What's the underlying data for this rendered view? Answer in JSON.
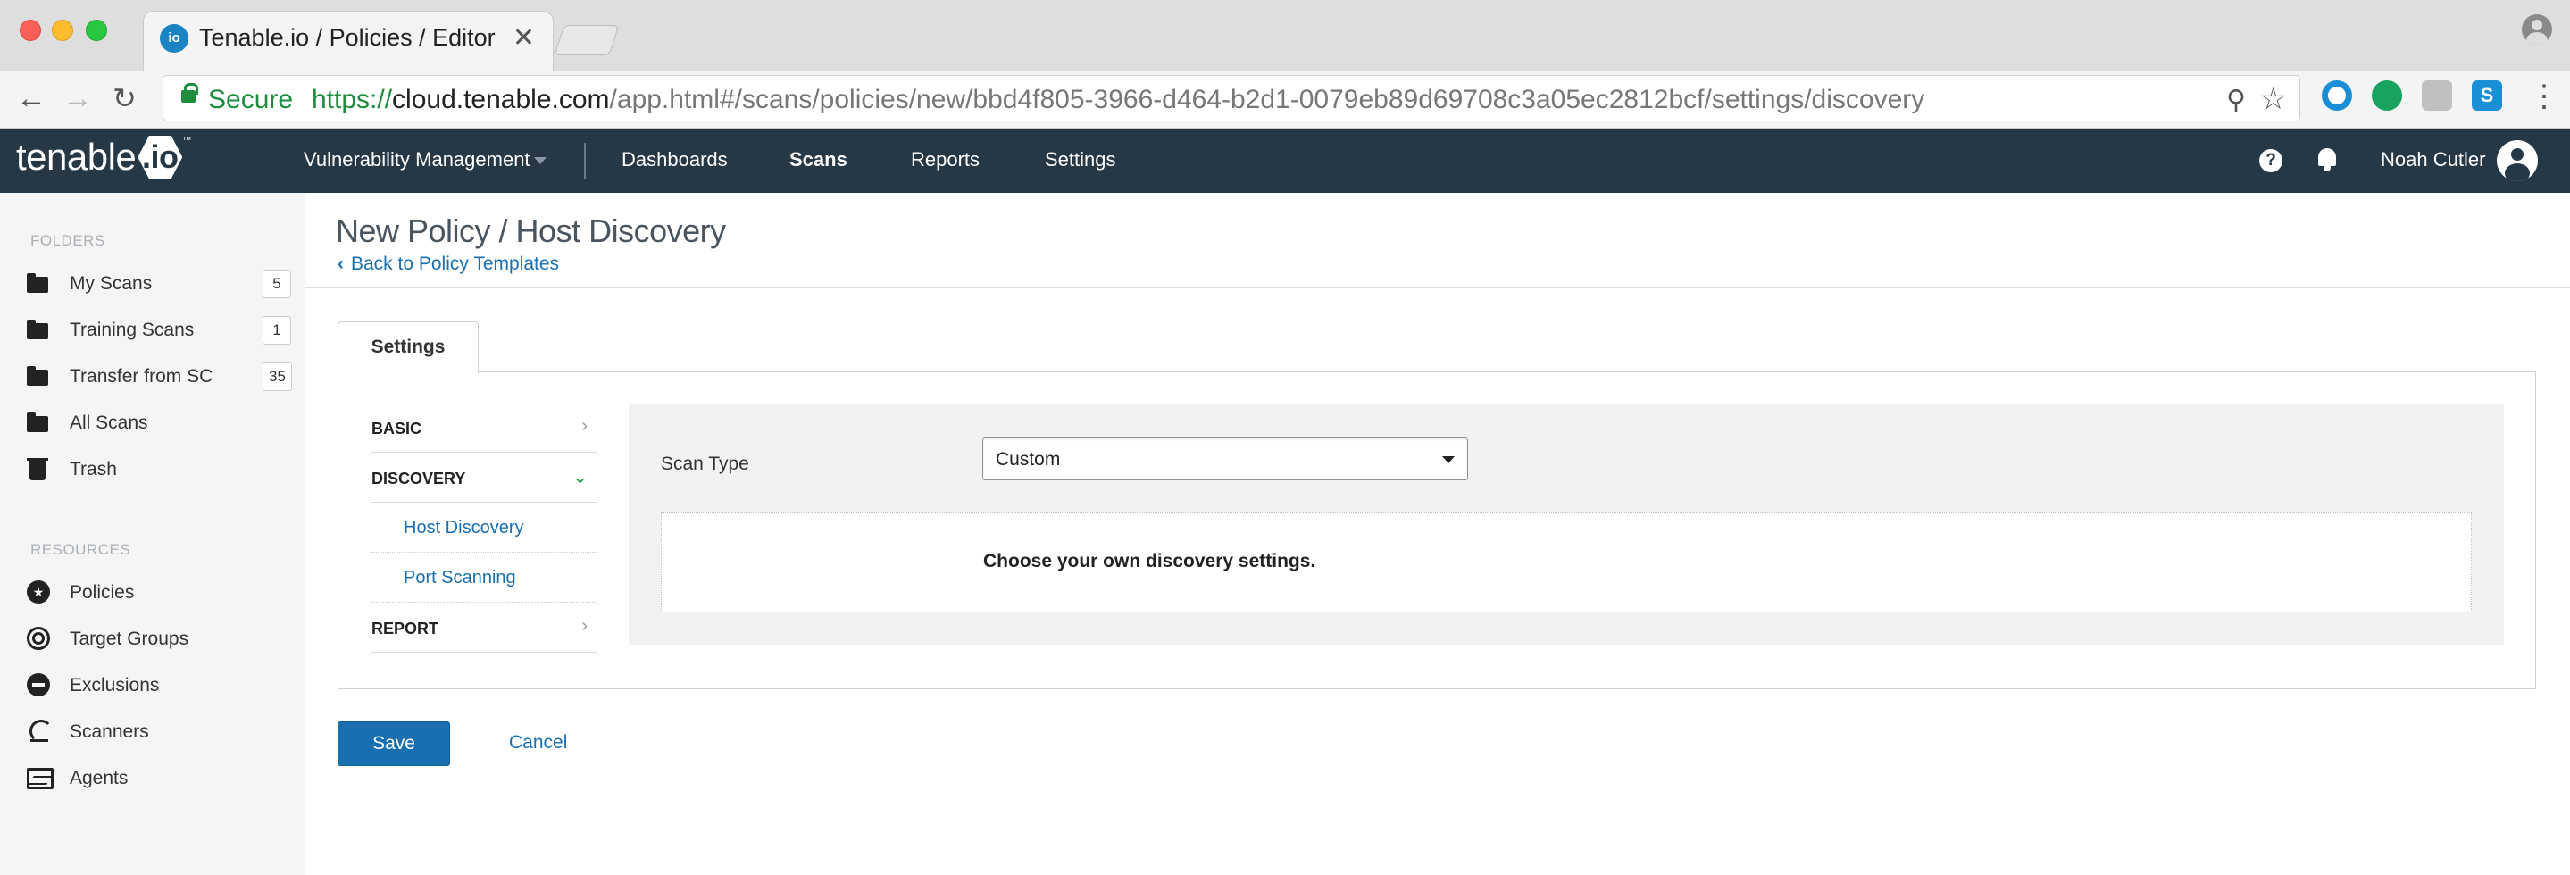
{
  "browser": {
    "tab_title": "Tenable.io / Policies / Editor",
    "tab_favicon": "io",
    "tab_close": "✕",
    "secure_label": "Secure",
    "url_scheme": "https://",
    "url_host": "cloud.tenable.com",
    "url_path": "/app.html#/scans/policies/new/bbd4f805-3966-d464-b2d1-0079eb89d69708c3a05ec2812bcf/settings/discovery",
    "extension_s": "S"
  },
  "header": {
    "logo_text": "tenable",
    "logo_badge": ".io",
    "logo_tm": "™",
    "nav": {
      "vulnerability_management": "Vulnerability Management",
      "dashboards": "Dashboards",
      "scans": "Scans",
      "reports": "Reports",
      "settings": "Settings"
    },
    "help": "?",
    "user_name": "Noah Cutler"
  },
  "sidebar": {
    "folders_heading": "FOLDERS",
    "folders": [
      {
        "label": "My Scans",
        "count": "5"
      },
      {
        "label": "Training Scans",
        "count": "1"
      },
      {
        "label": "Transfer from SC",
        "count": "35"
      },
      {
        "label": "All Scans"
      },
      {
        "label": "Trash"
      }
    ],
    "resources_heading": "RESOURCES",
    "resources": [
      {
        "label": "Policies"
      },
      {
        "label": "Target Groups"
      },
      {
        "label": "Exclusions"
      },
      {
        "label": "Scanners"
      },
      {
        "label": "Agents"
      }
    ]
  },
  "main": {
    "title": "New Policy / Host Discovery",
    "back_link": "Back to Policy Templates",
    "settings_tab": "Settings",
    "settings_nav": {
      "basic": "BASIC",
      "discovery": "DISCOVERY",
      "host_discovery": "Host Discovery",
      "port_scanning": "Port Scanning",
      "report": "REPORT"
    },
    "scan_type_label": "Scan Type",
    "scan_type_value": "Custom",
    "description": "Choose your own discovery settings.",
    "save_label": "Save",
    "cancel_label": "Cancel"
  },
  "colors": {
    "appbar": "#263746",
    "link": "#1a6fb0",
    "primary_button": "#1a6fb0",
    "secure_green": "#1e8e3e"
  }
}
